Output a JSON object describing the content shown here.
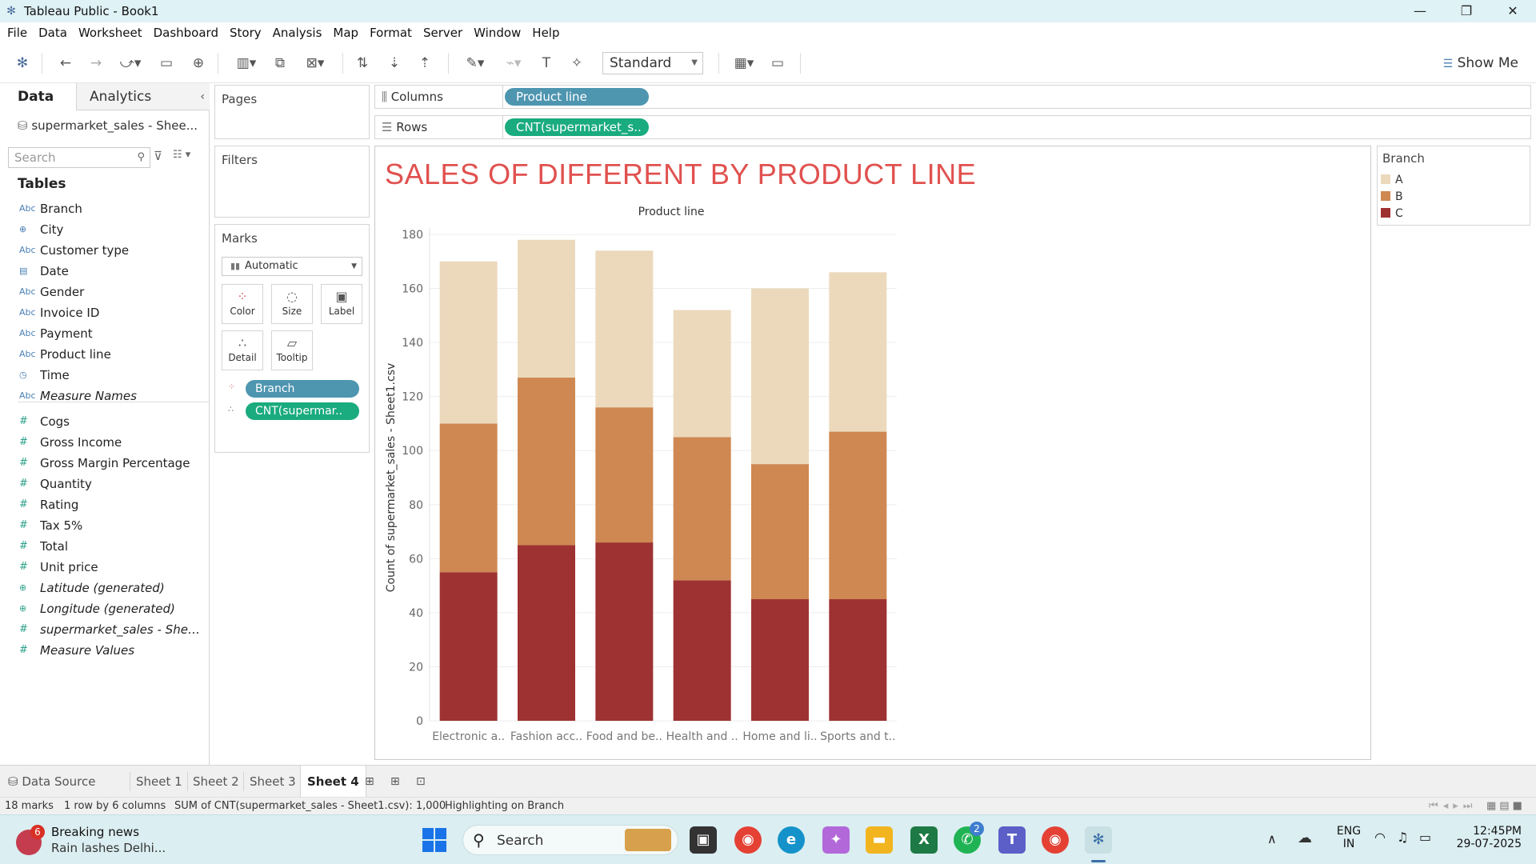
{
  "window": {
    "title": "Tableau Public - Book1"
  },
  "menu": [
    "File",
    "Data",
    "Worksheet",
    "Dashboard",
    "Story",
    "Analysis",
    "Map",
    "Format",
    "Server",
    "Window",
    "Help"
  ],
  "toolbar": {
    "fit_select": "Standard",
    "show_me": "Show Me"
  },
  "data_pane": {
    "tab_data": "Data",
    "tab_analytics": "Analytics",
    "datasource": "supermarket_sales - Shee...",
    "search_placeholder": "Search",
    "tables_header": "Tables",
    "dimensions": [
      {
        "icon": "Abc",
        "name": "Branch"
      },
      {
        "icon": "⊕",
        "name": "City"
      },
      {
        "icon": "Abc",
        "name": "Customer type"
      },
      {
        "icon": "▤",
        "name": "Date"
      },
      {
        "icon": "Abc",
        "name": "Gender"
      },
      {
        "icon": "Abc",
        "name": "Invoice ID"
      },
      {
        "icon": "Abc",
        "name": "Payment"
      },
      {
        "icon": "Abc",
        "name": "Product line"
      },
      {
        "icon": "◷",
        "name": "Time"
      },
      {
        "icon": "Abc",
        "name": "Measure Names"
      }
    ],
    "measures": [
      {
        "icon": "#",
        "name": "Cogs"
      },
      {
        "icon": "#",
        "name": "Gross Income"
      },
      {
        "icon": "#",
        "name": "Gross Margin Percentage"
      },
      {
        "icon": "#",
        "name": "Quantity"
      },
      {
        "icon": "#",
        "name": "Rating"
      },
      {
        "icon": "#",
        "name": "Tax 5%"
      },
      {
        "icon": "#",
        "name": "Total"
      },
      {
        "icon": "#",
        "name": "Unit price"
      },
      {
        "icon": "⊕",
        "name": "Latitude (generated)"
      },
      {
        "icon": "⊕",
        "name": "Longitude (generated)"
      },
      {
        "icon": "#",
        "name": "supermarket_sales - Sheet..."
      },
      {
        "icon": "#",
        "name": "Measure Values"
      }
    ]
  },
  "cards": {
    "pages": "Pages",
    "filters": "Filters",
    "marks": "Marks",
    "mark_type": "Automatic",
    "mark_buttons": [
      "Color",
      "Size",
      "Label",
      "Detail",
      "Tooltip"
    ],
    "mark_pills": [
      "Branch",
      "CNT(supermar.."
    ]
  },
  "shelves": {
    "columns_label": "Columns",
    "columns_pill": "Product line",
    "rows_label": "Rows",
    "rows_pill": "CNT(supermarket_s.."
  },
  "viz": {
    "title": "SALES OF DIFFERENT BY PRODUCT LINE"
  },
  "chart_data": {
    "type": "bar",
    "stacked": true,
    "title": "SALES OF DIFFERENT BY PRODUCT LINE",
    "xlabel": "Product line",
    "ylabel": "Count of supermarket_sales - Sheet1.csv",
    "categories": [
      "Electronic a..",
      "Fashion acc..",
      "Food and be..",
      "Health and ..",
      "Home and li..",
      "Sports and t.."
    ],
    "series": [
      {
        "name": "C",
        "color": "#9e3232",
        "values": [
          55,
          65,
          66,
          52,
          45,
          45
        ]
      },
      {
        "name": "B",
        "color": "#cf8851",
        "values": [
          55,
          62,
          50,
          53,
          50,
          62
        ]
      },
      {
        "name": "A",
        "color": "#ecd9bc",
        "values": [
          60,
          51,
          58,
          47,
          65,
          59
        ]
      }
    ],
    "ylim": [
      0,
      180
    ],
    "yticks": [
      0,
      20,
      40,
      60,
      80,
      100,
      120,
      140,
      160,
      180
    ],
    "grid": true,
    "legend_position": "right"
  },
  "legend": {
    "title": "Branch",
    "items": [
      {
        "label": "A",
        "color": "#ecd9bc"
      },
      {
        "label": "B",
        "color": "#cf8851"
      },
      {
        "label": "C",
        "color": "#9e3232"
      }
    ]
  },
  "sheet_tabs": {
    "data_source": "Data Source",
    "sheets": [
      "Sheet 1",
      "Sheet 2",
      "Sheet 3",
      "Sheet 4"
    ],
    "active": "Sheet 4"
  },
  "status": {
    "marks": "18 marks",
    "dims": "1 row by 6 columns",
    "sum": "SUM of CNT(supermarket_sales - Sheet1.csv): 1,000",
    "highlight": "Highlighting on Branch"
  },
  "taskbar": {
    "news_badge": "6",
    "news_title": "Breaking news",
    "news_sub": "Rain lashes Delhi...",
    "search": "Search",
    "whatsapp_badge": "2",
    "lang1": "ENG",
    "lang2": "IN",
    "time": "12:45PM",
    "date": "29-07-2025"
  }
}
